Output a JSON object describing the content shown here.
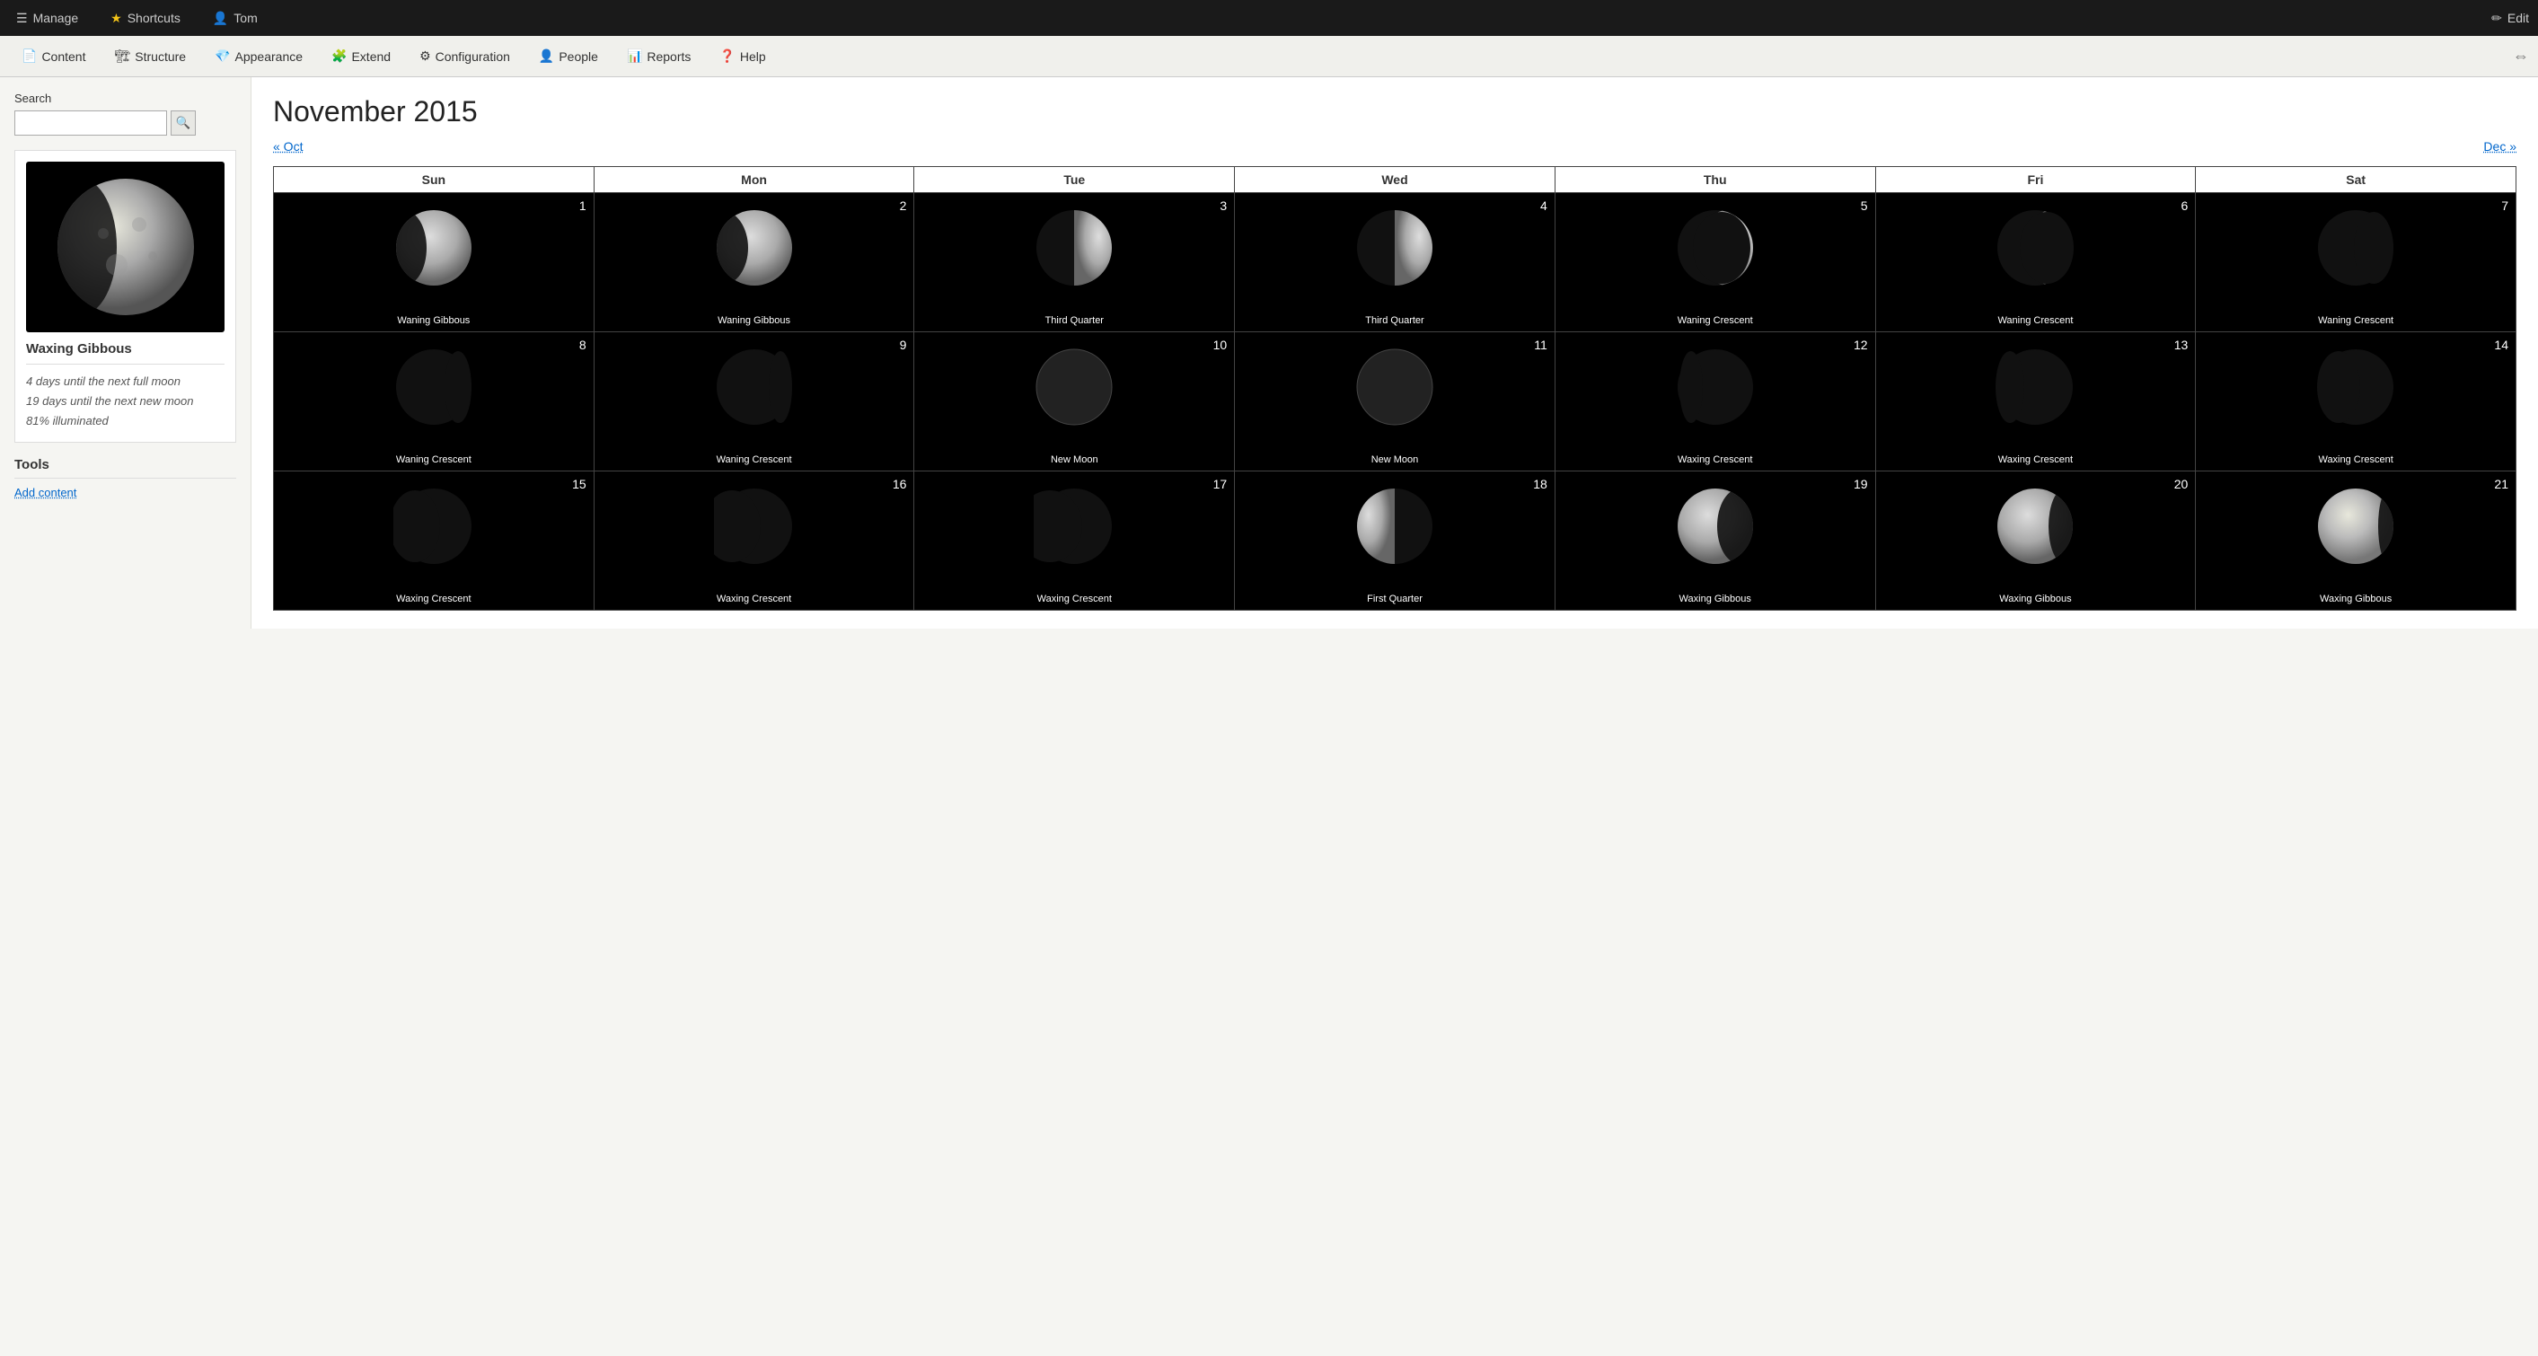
{
  "topbar": {
    "manage_label": "Manage",
    "shortcuts_label": "Shortcuts",
    "user_label": "Tom",
    "edit_label": "Edit"
  },
  "navbar": {
    "items": [
      {
        "id": "content",
        "label": "Content",
        "icon": "📄"
      },
      {
        "id": "structure",
        "label": "Structure",
        "icon": "🏗"
      },
      {
        "id": "appearance",
        "label": "Appearance",
        "icon": "💎"
      },
      {
        "id": "extend",
        "label": "Extend",
        "icon": "🧩"
      },
      {
        "id": "configuration",
        "label": "Configuration",
        "icon": "⚙"
      },
      {
        "id": "people",
        "label": "People",
        "icon": "👤"
      },
      {
        "id": "reports",
        "label": "Reports",
        "icon": "📊"
      },
      {
        "id": "help",
        "label": "Help",
        "icon": "❓"
      }
    ]
  },
  "sidebar": {
    "search_label": "Search",
    "search_placeholder": "",
    "moon_name": "Waxing Gibbous",
    "moon_info": {
      "days_full": "4",
      "days_new": "19",
      "illuminated": "81"
    },
    "tools_label": "Tools",
    "tools_link": "Add content"
  },
  "calendar": {
    "title": "November 2015",
    "prev_label": "« Oct",
    "next_label": "Dec »",
    "headers": [
      "Sun",
      "Mon",
      "Tue",
      "Wed",
      "Thu",
      "Fri",
      "Sat"
    ],
    "weeks": [
      [
        {
          "day": 1,
          "phase": "Waning Gibbous",
          "type": "waning-gibbous"
        },
        {
          "day": 2,
          "phase": "Waning Gibbous",
          "type": "waning-gibbous"
        },
        {
          "day": 3,
          "phase": "Third Quarter",
          "type": "third-quarter"
        },
        {
          "day": 4,
          "phase": "Third Quarter",
          "type": "third-quarter"
        },
        {
          "day": 5,
          "phase": "Waning Crescent",
          "type": "waning-crescent-wide"
        },
        {
          "day": 6,
          "phase": "Waning Crescent",
          "type": "waning-crescent-mid"
        },
        {
          "day": 7,
          "phase": "Waning Crescent",
          "type": "waning-crescent-thin"
        }
      ],
      [
        {
          "day": 8,
          "phase": "Waning Crescent",
          "type": "waning-crescent-vthin"
        },
        {
          "day": 9,
          "phase": "Waning Crescent",
          "type": "waning-crescent-vthin"
        },
        {
          "day": 10,
          "phase": "New Moon",
          "type": "new-moon"
        },
        {
          "day": 11,
          "phase": "New Moon",
          "type": "new-moon"
        },
        {
          "day": 12,
          "phase": "Waxing Crescent",
          "type": "waxing-crescent-vthin"
        },
        {
          "day": 13,
          "phase": "Waxing Crescent",
          "type": "waxing-crescent-thin"
        },
        {
          "day": 14,
          "phase": "Waxing Crescent",
          "type": "waxing-crescent-mid"
        }
      ],
      [
        {
          "day": 15,
          "phase": "Waxing Crescent",
          "type": "waxing-crescent-mid"
        },
        {
          "day": 16,
          "phase": "Waxing Crescent",
          "type": "waxing-crescent-wide"
        },
        {
          "day": 17,
          "phase": "Waxing Crescent",
          "type": "waxing-crescent-wider"
        },
        {
          "day": 18,
          "phase": "First Quarter",
          "type": "first-quarter"
        },
        {
          "day": 19,
          "phase": "Waxing Gibbous",
          "type": "waxing-gibbous"
        },
        {
          "day": 20,
          "phase": "Waxing Gibbous",
          "type": "waxing-gibbous"
        },
        {
          "day": 21,
          "phase": "Waxing Gibbous",
          "type": "waxing-gibbous-full"
        }
      ]
    ]
  }
}
